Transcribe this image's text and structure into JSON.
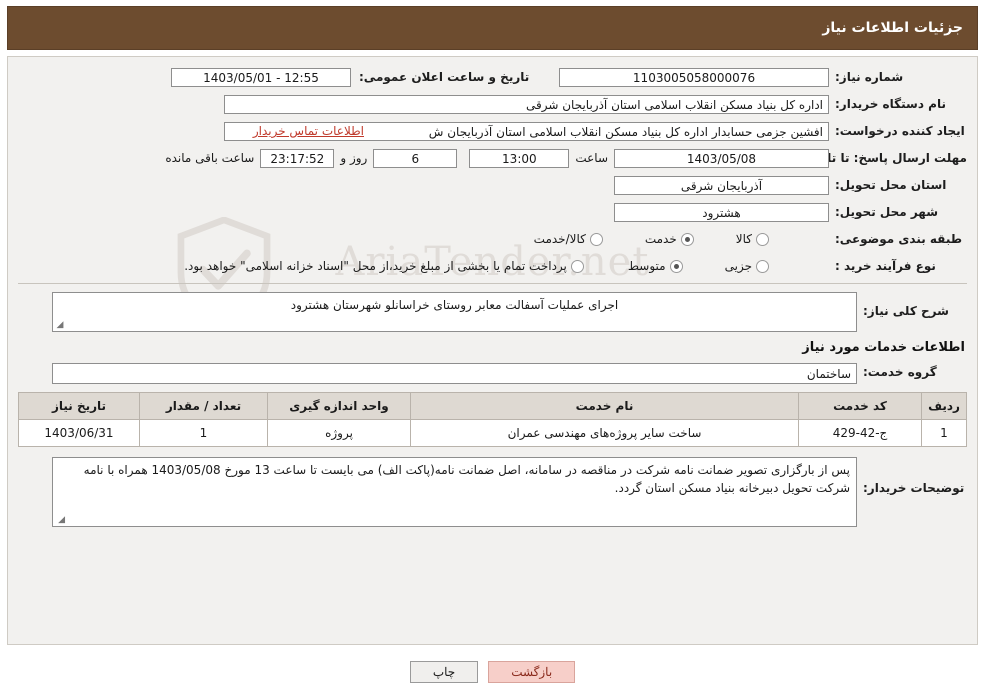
{
  "header": {
    "title": "جزئیات اطلاعات نیاز"
  },
  "form": {
    "need_number_label": "شماره نیاز:",
    "need_number_value": "1103005058000076",
    "announce_datetime_label": "تاریخ و ساعت اعلان عمومی:",
    "announce_datetime_value": "12:55 - 1403/05/01",
    "buyer_org_label": "نام دستگاه خریدار:",
    "buyer_org_value": "اداره کل بنیاد مسکن انقلاب اسلامی استان آذربایجان شرقی",
    "requester_label": "ایجاد کننده درخواست:",
    "requester_value": "افشین جزمی حسابدار اداره کل بنیاد مسکن انقلاب اسلامی استان آذربایجان ش",
    "contact_link": "اطلاعات تماس خریدار",
    "deadline_label": "مهلت ارسال پاسخ: تا تاریخ:",
    "deadline_date": "1403/05/08",
    "deadline_hour_label": "ساعت",
    "deadline_hour": "13:00",
    "remaining_days": "6",
    "remaining_days_label": "روز و",
    "remaining_time": "23:17:52",
    "remaining_suffix": "ساعت باقی مانده",
    "province_label": "استان محل تحویل:",
    "province_value": "آذربایجان شرقی",
    "city_label": "شهر محل تحویل:",
    "city_value": "هشترود",
    "category_label": "طبقه بندی موضوعی:",
    "category_options": [
      {
        "label": "کالا",
        "checked": false
      },
      {
        "label": "خدمت",
        "checked": true
      },
      {
        "label": "کالا/خدمت",
        "checked": false
      }
    ],
    "process_label": "نوع فرآیند خرید :",
    "process_options": [
      {
        "label": "جزیی",
        "checked": false
      },
      {
        "label": "متوسط",
        "checked": true
      }
    ],
    "process_note": "پرداخت تمام یا بخشی از مبلغ خرید،از محل \"اسناد خزانه اسلامی\" خواهد بود."
  },
  "description": {
    "general_label": "شرح کلی نیاز:",
    "general_value": "اجرای عملیات آسفالت معابر روستای خراسانلو شهرستان هشترود",
    "services_title": "اطلاعات خدمات مورد نیاز",
    "group_label": "گروه خدمت:",
    "group_value": "ساختمان"
  },
  "table": {
    "headers": [
      "ردیف",
      "کد خدمت",
      "نام خدمت",
      "واحد اندازه گیری",
      "تعداد / مقدار",
      "تاریخ نیاز"
    ],
    "rows": [
      {
        "row": "1",
        "code": "ج-42-429",
        "name": "ساخت سایر پروژه‌های مهندسی عمران",
        "unit": "پروژه",
        "qty": "1",
        "date": "1403/06/31"
      }
    ]
  },
  "buyer_notes": {
    "label": "توضیحات خریدار:",
    "value": "پس از بارگزاری تصویر ضمانت نامه شرکت در مناقصه در سامانه، اصل ضمانت نامه(پاکت الف) می بایست تا ساعت 13 مورخ 1403/05/08 همراه با نامه شرکت تحویل دبیرخانه بنیاد مسکن استان گردد."
  },
  "footer": {
    "print_label": "چاپ",
    "back_label": "بازگشت"
  },
  "watermark": {
    "text": "AriaTender.net",
    "icon": "shield-icon"
  },
  "colors": {
    "header_bg": "#6d4c2f",
    "panel_bg": "#f2f1ef",
    "link": "#c0392b",
    "back_button": "#f7cfc9"
  }
}
